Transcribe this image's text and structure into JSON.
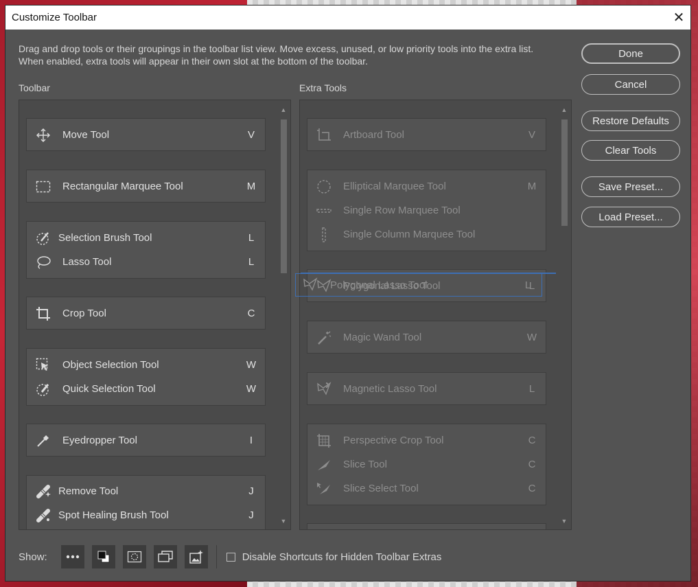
{
  "dialog": {
    "title": "Customize Toolbar",
    "close_glyph": "✕",
    "description": "Drag and drop tools or their groupings in the toolbar list view. Move excess, unused, or low priority tools into the extra list. When enabled, extra tools will appear in their own slot at the bottom of the toolbar."
  },
  "toolbar": {
    "label": "Toolbar",
    "groups": [
      {
        "tools": [
          {
            "name": "Move Tool",
            "key": "V",
            "icon": "move-icon"
          }
        ]
      },
      {
        "tools": [
          {
            "name": "Rectangular Marquee Tool",
            "key": "M",
            "icon": "rectangular-marquee-icon"
          }
        ]
      },
      {
        "tools": [
          {
            "name": "Selection Brush Tool",
            "key": "L",
            "icon": "selection-brush-icon"
          },
          {
            "name": "Lasso Tool",
            "key": "L",
            "icon": "lasso-icon"
          }
        ]
      },
      {
        "tools": [
          {
            "name": "Crop Tool",
            "key": "C",
            "icon": "crop-icon"
          }
        ]
      },
      {
        "tools": [
          {
            "name": "Object Selection Tool",
            "key": "W",
            "icon": "object-selection-icon"
          },
          {
            "name": "Quick Selection Tool",
            "key": "W",
            "icon": "quick-selection-icon"
          }
        ]
      },
      {
        "tools": [
          {
            "name": "Eyedropper Tool",
            "key": "I",
            "icon": "eyedropper-icon"
          }
        ]
      },
      {
        "tools": [
          {
            "name": "Remove Tool",
            "key": "J",
            "icon": "remove-tool-icon"
          },
          {
            "name": "Spot Healing Brush Tool",
            "key": "J",
            "icon": "spot-healing-icon"
          }
        ]
      }
    ]
  },
  "extra_tools": {
    "label": "Extra Tools",
    "groups": [
      {
        "tools": [
          {
            "name": "Artboard Tool",
            "key": "V",
            "icon": "artboard-icon"
          }
        ]
      },
      {
        "tools": [
          {
            "name": "Elliptical Marquee Tool",
            "key": "M",
            "icon": "elliptical-marquee-icon"
          },
          {
            "name": "Single Row Marquee Tool",
            "key": "",
            "icon": "single-row-marquee-icon"
          },
          {
            "name": "Single Column Marquee Tool",
            "key": "",
            "icon": "single-column-marquee-icon"
          }
        ]
      },
      {
        "tools": [
          {
            "name": "Polygonal Lasso Tool",
            "key": "L",
            "icon": "polygonal-lasso-icon"
          }
        ]
      },
      {
        "tools": [
          {
            "name": "Magic Wand Tool",
            "key": "W",
            "icon": "magic-wand-icon"
          }
        ]
      },
      {
        "tools": [
          {
            "name": "Magnetic Lasso Tool",
            "key": "L",
            "icon": "magnetic-lasso-icon"
          }
        ]
      },
      {
        "tools": [
          {
            "name": "Perspective Crop Tool",
            "key": "C",
            "icon": "perspective-crop-icon"
          },
          {
            "name": "Slice Tool",
            "key": "C",
            "icon": "slice-icon"
          },
          {
            "name": "Slice Select Tool",
            "key": "C",
            "icon": "slice-select-icon"
          }
        ]
      }
    ],
    "drag_ghost": {
      "name": "Polygonal Lasso Tool",
      "key": "L"
    }
  },
  "buttons": {
    "done": "Done",
    "cancel": "Cancel",
    "restore_defaults": "Restore Defaults",
    "clear_tools": "Clear Tools",
    "save_preset": "Save Preset...",
    "load_preset": "Load Preset..."
  },
  "bottom": {
    "show_label": "Show:",
    "show_icons": [
      "ellipsis-icon",
      "color-swatch-icon",
      "quick-mask-icon",
      "screen-mode-icon",
      "generative-icon"
    ],
    "checkbox_label": "Disable Shortcuts for Hidden Toolbar Extras",
    "checkbox_checked": false
  },
  "colors": {
    "dialog_bg": "#535353",
    "panel_bg": "#4a4a4a",
    "drag_highlight": "#3d6fb5"
  }
}
